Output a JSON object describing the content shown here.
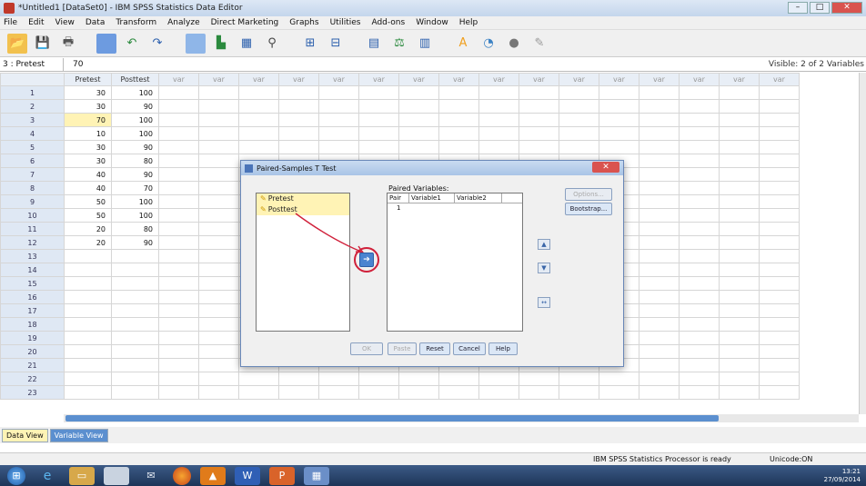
{
  "window": {
    "title": "*Untitled1 [DataSet0] - IBM SPSS Statistics Data Editor",
    "min": "–",
    "max": "□",
    "close": "✕"
  },
  "menu": [
    "File",
    "Edit",
    "View",
    "Data",
    "Transform",
    "Analyze",
    "Direct Marketing",
    "Graphs",
    "Utilities",
    "Add-ons",
    "Window",
    "Help"
  ],
  "toolbar_icons": [
    "open-icon",
    "save-icon",
    "print-icon",
    "dialog-recall-icon",
    "undo-icon",
    "redo-icon",
    "goto-case-icon",
    "goto-variable-icon",
    "variables-icon",
    "find-icon",
    "insert-cases-icon",
    "insert-variable-icon",
    "split-file-icon",
    "weight-cases-icon",
    "select-cases-icon",
    "value-labels-icon",
    "use-sets-icon",
    "show-all-variables-icon",
    "spelling-icon"
  ],
  "cellbar": {
    "ref": "3 : Pretest",
    "value": "70",
    "visible": "Visible: 2 of 2 Variables"
  },
  "columns": [
    "Pretest",
    "Posttest",
    "var",
    "var",
    "var",
    "var",
    "var",
    "var",
    "var",
    "var",
    "var",
    "var",
    "var",
    "var",
    "var",
    "var",
    "var",
    "var"
  ],
  "rows": [
    {
      "n": "1",
      "pre": "30",
      "post": "100"
    },
    {
      "n": "2",
      "pre": "30",
      "post": "90"
    },
    {
      "n": "3",
      "pre": "70",
      "post": "100"
    },
    {
      "n": "4",
      "pre": "10",
      "post": "100"
    },
    {
      "n": "5",
      "pre": "30",
      "post": "90"
    },
    {
      "n": "6",
      "pre": "30",
      "post": "80"
    },
    {
      "n": "7",
      "pre": "40",
      "post": "90"
    },
    {
      "n": "8",
      "pre": "40",
      "post": "70"
    },
    {
      "n": "9",
      "pre": "50",
      "post": "100"
    },
    {
      "n": "10",
      "pre": "50",
      "post": "100"
    },
    {
      "n": "11",
      "pre": "20",
      "post": "80"
    },
    {
      "n": "12",
      "pre": "20",
      "post": "90"
    },
    {
      "n": "13",
      "pre": "",
      "post": ""
    },
    {
      "n": "14",
      "pre": "",
      "post": ""
    },
    {
      "n": "15",
      "pre": "",
      "post": ""
    },
    {
      "n": "16",
      "pre": "",
      "post": ""
    },
    {
      "n": "17",
      "pre": "",
      "post": ""
    },
    {
      "n": "18",
      "pre": "",
      "post": ""
    },
    {
      "n": "19",
      "pre": "",
      "post": ""
    },
    {
      "n": "20",
      "pre": "",
      "post": ""
    },
    {
      "n": "21",
      "pre": "",
      "post": ""
    },
    {
      "n": "22",
      "pre": "",
      "post": ""
    },
    {
      "n": "23",
      "pre": "",
      "post": ""
    }
  ],
  "tabs": {
    "data_view": "Data View",
    "variable_view": "Variable View"
  },
  "status": {
    "processor": "IBM SPSS Statistics Processor is ready",
    "unicode": "Unicode:ON"
  },
  "dialog": {
    "title": "Paired-Samples T Test",
    "close": "✕",
    "variables": [
      "Pretest",
      "Posttest"
    ],
    "paired_label": "Paired Variables:",
    "headers": [
      "Pair",
      "Variable1",
      "Variable2"
    ],
    "pair_row": "1",
    "move_symbol": "➔",
    "up": "▲",
    "down": "▼",
    "swap": "↔",
    "options": "Options...",
    "bootstrap": "Bootstrap...",
    "ok": "OK",
    "paste": "Paste",
    "reset": "Reset",
    "cancel": "Cancel",
    "help": "Help"
  },
  "taskbar": {
    "icons": [
      "start-icon",
      "ie-icon",
      "explorer-icon",
      "library-icon",
      "outlook-icon",
      "firefox-icon",
      "paint-icon",
      "word-icon",
      "powerpoint-icon",
      "spss-icon"
    ],
    "time": "13:21",
    "date": "27/09/2014"
  },
  "colors": {
    "accent": "#5b8fcf",
    "selection": "#fff3b5",
    "annotation": "#d0203a"
  }
}
